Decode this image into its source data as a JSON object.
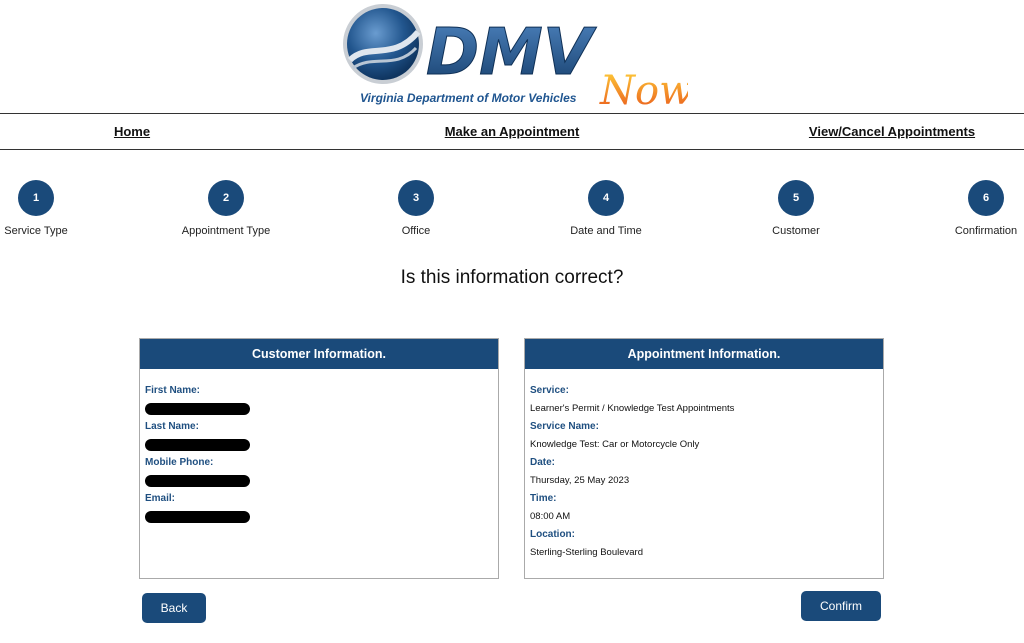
{
  "header": {
    "logo_text": "DMV",
    "logo_accent_text": "Now",
    "logo_subtitle": "Virginia Department of Motor Vehicles"
  },
  "nav": {
    "items": [
      {
        "label": "Home"
      },
      {
        "label": "Make an Appointment"
      },
      {
        "label": "View/Cancel Appointments"
      }
    ]
  },
  "steps": [
    {
      "number": "1",
      "label": "Service Type"
    },
    {
      "number": "2",
      "label": "Appointment Type"
    },
    {
      "number": "3",
      "label": "Office"
    },
    {
      "number": "4",
      "label": "Date and Time"
    },
    {
      "number": "5",
      "label": "Customer"
    },
    {
      "number": "6",
      "label": "Confirmation"
    }
  ],
  "question": "Is this information correct?",
  "customer_panel": {
    "title": "Customer Information.",
    "fields": [
      {
        "label": "First Name:",
        "value": "[redacted]"
      },
      {
        "label": "Last Name:",
        "value": "[redacted]"
      },
      {
        "label": "Mobile Phone:",
        "value": "[redacted]"
      },
      {
        "label": "Email:",
        "value": "[redacted]"
      }
    ]
  },
  "appointment_panel": {
    "title": "Appointment Information.",
    "fields": [
      {
        "label": "Service:",
        "value": "Learner's Permit / Knowledge Test Appointments"
      },
      {
        "label": "Service Name:",
        "value": "Knowledge Test: Car or Motorcycle Only"
      },
      {
        "label": "Date:",
        "value": "Thursday, 25 May 2023"
      },
      {
        "label": "Time:",
        "value": "08:00 AM"
      },
      {
        "label": "Location:",
        "value": "Sterling-Sterling Boulevard"
      }
    ]
  },
  "buttons": {
    "back": "Back",
    "confirm": "Confirm"
  },
  "colors": {
    "brand_blue": "#1a4a7a",
    "label_blue": "#1f4f80",
    "accent_orange": "#f08a1c"
  }
}
